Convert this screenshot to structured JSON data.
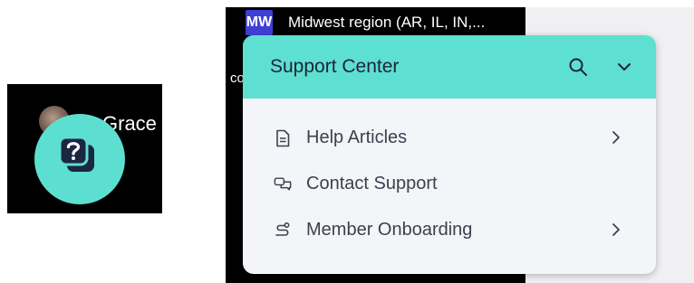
{
  "launcher": {
    "name_fragment": "Grace T",
    "icon": "help-question-icon",
    "color": "#5cdfd1"
  },
  "region": {
    "badge": "MW",
    "label": "Midwest region (AR, IL, IN,...",
    "badge_color": "#3f3fd6"
  },
  "cut_label": "co",
  "panel": {
    "title": "Support Center",
    "header_color": "#5ddfd2",
    "search_icon": "search-icon",
    "collapse_icon": "chevron-down-icon",
    "items": [
      {
        "label": "Help Articles",
        "icon": "document-icon",
        "has_submenu": true
      },
      {
        "label": "Contact Support",
        "icon": "chat-bubbles-icon",
        "has_submenu": false
      },
      {
        "label": "Member Onboarding",
        "icon": "route-icon",
        "has_submenu": true
      }
    ]
  }
}
